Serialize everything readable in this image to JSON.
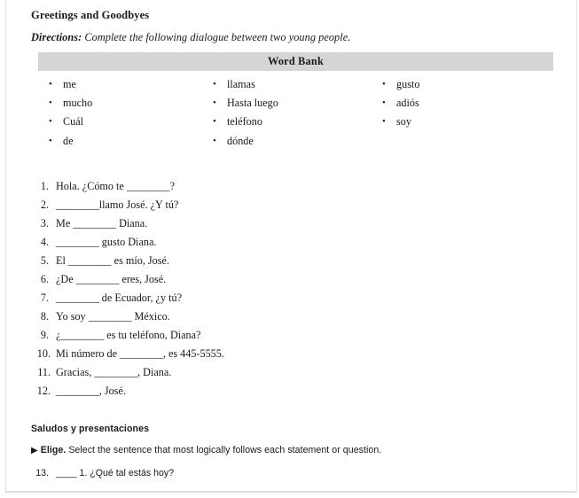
{
  "worksheet": {
    "title": "Greetings and Goodbyes",
    "directions_lead": "Directions:",
    "directions_text": "Complete the following dialogue between two young people."
  },
  "word_bank": {
    "header": "Word Bank",
    "bullet_glyph": "•",
    "header_bg": "#d5d5d5",
    "columns": [
      [
        "me",
        "mucho",
        "Cuál",
        "de"
      ],
      [
        "llamas",
        "Hasta luego",
        "teléfono",
        "dónde"
      ],
      [
        "gusto",
        "adiós",
        "soy"
      ]
    ]
  },
  "fill_in_items": [
    {
      "number": "1.",
      "text": "Hola. ¿Cómo te ________?"
    },
    {
      "number": "2.",
      "text": "________llamo José. ¿Y tú?"
    },
    {
      "number": "3.",
      "text": "Me ________ Diana."
    },
    {
      "number": "4.",
      "text": "________ gusto Diana."
    },
    {
      "number": "5.",
      "text": "El ________ es mío, José."
    },
    {
      "number": "6.",
      "text": "¿De ________ eres, José."
    },
    {
      "number": "7.",
      "text": "________ de Ecuador, ¿y tú?"
    },
    {
      "number": "8.",
      "text": "Yo soy ________ México."
    },
    {
      "number": "9.",
      "text": "¿________ es tu teléfono, Diana?"
    },
    {
      "number": "10.",
      "text": "Mi número de ________, es 445-5555."
    },
    {
      "number": "11.",
      "text": "Gracias, ________, Diana."
    },
    {
      "number": "12.",
      "text": "________, José."
    }
  ],
  "section2": {
    "title": "Saludos y presentaciones",
    "triangle_glyph": "▶",
    "instruction_lead": "Elige.",
    "instruction_text": "Select the sentence that most logically follows each statement or question.",
    "items": [
      {
        "number": "13.",
        "text": "____ 1. ¿Qué tal estás hoy?"
      }
    ]
  }
}
